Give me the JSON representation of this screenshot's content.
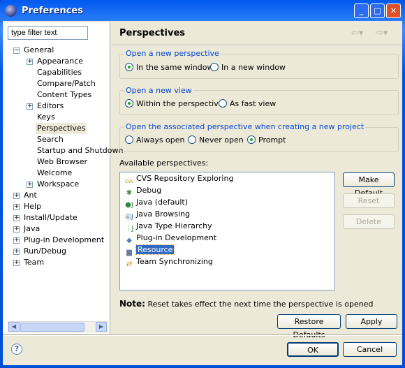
{
  "window": {
    "title": "Preferences",
    "minimize": "_",
    "maximize": "□",
    "close": "✕"
  },
  "filter": {
    "value": "type filter text"
  },
  "tree": [
    {
      "label": "General",
      "level": 0,
      "expander": "−"
    },
    {
      "label": "Appearance",
      "level": 1,
      "expander": "+"
    },
    {
      "label": "Capabilities",
      "level": 1
    },
    {
      "label": "Compare/Patch",
      "level": 1
    },
    {
      "label": "Content Types",
      "level": 1
    },
    {
      "label": "Editors",
      "level": 1,
      "expander": "+"
    },
    {
      "label": "Keys",
      "level": 1
    },
    {
      "label": "Perspectives",
      "level": 1,
      "selected": true
    },
    {
      "label": "Search",
      "level": 1
    },
    {
      "label": "Startup and Shutdown",
      "level": 1
    },
    {
      "label": "Web Browser",
      "level": 1
    },
    {
      "label": "Welcome",
      "level": 1
    },
    {
      "label": "Workspace",
      "level": 1,
      "expander": "+"
    },
    {
      "label": "Ant",
      "level": 0,
      "expander": "+"
    },
    {
      "label": "Help",
      "level": 0,
      "expander": "+"
    },
    {
      "label": "Install/Update",
      "level": 0,
      "expander": "+"
    },
    {
      "label": "Java",
      "level": 0,
      "expander": "+"
    },
    {
      "label": "Plug-in Development",
      "level": 0,
      "expander": "+"
    },
    {
      "label": "Run/Debug",
      "level": 0,
      "expander": "+"
    },
    {
      "label": "Team",
      "level": 0,
      "expander": "+"
    }
  ],
  "page": {
    "title": "Perspectives",
    "back_icon": "arrow-left-icon",
    "forward_icon": "arrow-right-icon"
  },
  "groups": [
    {
      "label": "Open a new perspective",
      "options": [
        {
          "label": "In the same window",
          "checked": true
        },
        {
          "label": "In a new window",
          "checked": false
        }
      ]
    },
    {
      "label": "Open a new view",
      "options": [
        {
          "label": "Within the perspective",
          "checked": true
        },
        {
          "label": "As fast view",
          "checked": false
        }
      ]
    },
    {
      "label": "Open the associated perspective when creating a new project",
      "options": [
        {
          "label": "Always open",
          "checked": false
        },
        {
          "label": "Never open",
          "checked": false
        },
        {
          "label": "Prompt",
          "checked": true
        }
      ]
    }
  ],
  "available_label": "Available perspectives:",
  "perspectives": [
    {
      "label": "CVS Repository Exploring",
      "icon": "cvs-icon"
    },
    {
      "label": "Debug",
      "icon": "bug-icon"
    },
    {
      "label": "Java (default)",
      "icon": "java-icon"
    },
    {
      "label": "Java Browsing",
      "icon": "java-browsing-icon"
    },
    {
      "label": "Java Type Hierarchy",
      "icon": "hierarchy-icon"
    },
    {
      "label": "Plug-in Development",
      "icon": "plugin-icon"
    },
    {
      "label": "Resource",
      "icon": "resource-icon",
      "selected": true
    },
    {
      "label": "Team Synchronizing",
      "icon": "sync-icon"
    }
  ],
  "buttons": {
    "make_default": "Make Default",
    "reset": "Reset",
    "delete": "Delete",
    "restore_defaults": "Restore Defaults",
    "apply": "Apply",
    "ok": "OK",
    "cancel": "Cancel"
  },
  "note": {
    "label": "Note:",
    "text": "Reset takes effect the next time the perspective is opened"
  },
  "help": "?"
}
